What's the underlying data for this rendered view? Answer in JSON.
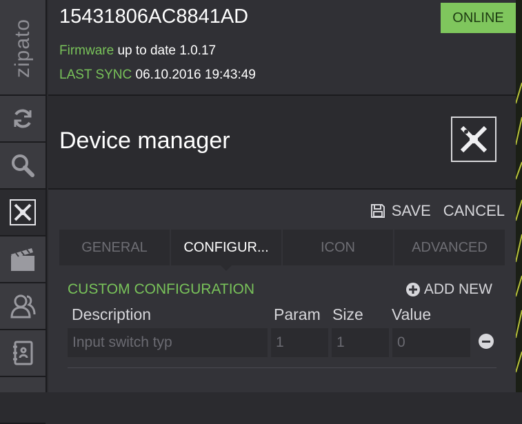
{
  "sidebar": {
    "logo": "zipato",
    "items": [
      {
        "icon": "sync-icon"
      },
      {
        "icon": "search-icon"
      },
      {
        "icon": "device-manager-icon"
      },
      {
        "icon": "clapperboard-icon"
      },
      {
        "icon": "users-icon"
      },
      {
        "icon": "address-book-icon"
      }
    ]
  },
  "header": {
    "serial": "15431806AC8841AD",
    "status": "ONLINE",
    "firmware_label": "Firmware",
    "firmware_value": "up to date 1.0.17",
    "sync_label": "LAST SYNC",
    "sync_value": "06.10.2016 19:43:49"
  },
  "page": {
    "title": "Device manager",
    "title_icon": "device-manager-icon"
  },
  "actions": {
    "save_label": "SAVE",
    "cancel_label": "CANCEL"
  },
  "tabs": [
    {
      "label": "GENERAL",
      "active": false
    },
    {
      "label": "CONFIGUR...",
      "active": true
    },
    {
      "label": "ICON",
      "active": false
    },
    {
      "label": "ADVANCED",
      "active": false
    }
  ],
  "config": {
    "section_title": "CUSTOM CONFIGURATION",
    "add_new_label": "ADD NEW",
    "columns": {
      "description": "Description",
      "param": "Param",
      "size": "Size",
      "value": "Value"
    },
    "rows": [
      {
        "description": "Input switch typ",
        "param": "1",
        "size": "1",
        "value": "0"
      }
    ]
  },
  "colors": {
    "accent_green": "#79c35a",
    "online_bg": "#7fc65d",
    "background": "#2b2b2f"
  }
}
